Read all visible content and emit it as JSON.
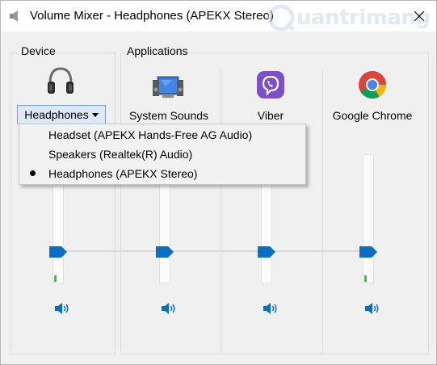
{
  "window": {
    "title": "Volume Mixer - Headphones (APEKX Stereo)",
    "watermark": "uantrimang"
  },
  "device": {
    "group_label": "Device",
    "selected_device": "Headphones"
  },
  "applications": {
    "group_label": "Applications",
    "items": [
      {
        "name": "System Sounds"
      },
      {
        "name": "Viber"
      },
      {
        "name": "Google Chrome"
      }
    ]
  },
  "device_menu": {
    "items": [
      {
        "label": "Headset (APEKX Hands-Free AG Audio)",
        "selected": false
      },
      {
        "label": "Speakers (Realtek(R) Audio)",
        "selected": false
      },
      {
        "label": "Headphones (APEKX Stereo)",
        "selected": true
      }
    ]
  },
  "colors": {
    "accent_blue": "#0a6fc2",
    "level_green": "#2ecc40",
    "viber_purple": "#7d4fcf"
  }
}
